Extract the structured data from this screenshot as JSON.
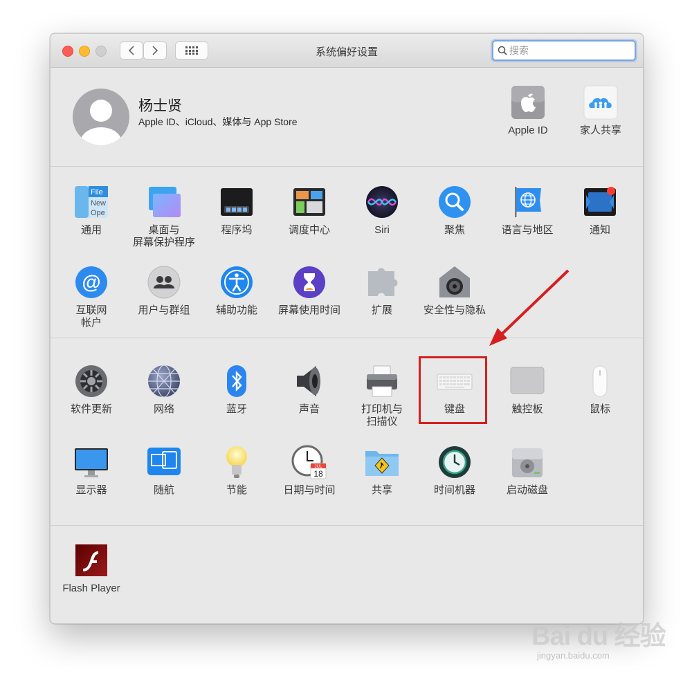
{
  "window": {
    "title": "系统偏好设置"
  },
  "search": {
    "placeholder": "搜索"
  },
  "user": {
    "name": "杨士贤",
    "subtitle": "Apple ID、iCloud、媒体与 App Store"
  },
  "top_right": [
    {
      "label": "Apple ID",
      "icon": "apple-id-icon"
    },
    {
      "label": "家人共享",
      "icon": "family-sharing-icon"
    }
  ],
  "section1": [
    {
      "label": "通用",
      "icon": "general-icon"
    },
    {
      "label": "桌面与",
      "label2": "屏幕保护程序",
      "icon": "desktop-screensaver-icon"
    },
    {
      "label": "程序坞",
      "icon": "dock-icon"
    },
    {
      "label": "调度中心",
      "icon": "mission-control-icon"
    },
    {
      "label": "Siri",
      "icon": "siri-icon"
    },
    {
      "label": "聚焦",
      "icon": "spotlight-icon"
    },
    {
      "label": "语言与地区",
      "icon": "language-region-icon"
    },
    {
      "label": "通知",
      "icon": "notifications-icon"
    },
    {
      "label": "互联网",
      "label2": "帐户",
      "icon": "internet-accounts-icon"
    },
    {
      "label": "用户与群组",
      "icon": "users-groups-icon"
    },
    {
      "label": "辅助功能",
      "icon": "accessibility-icon"
    },
    {
      "label": "屏幕使用时间",
      "icon": "screen-time-icon"
    },
    {
      "label": "扩展",
      "icon": "extensions-icon"
    },
    {
      "label": "安全性与隐私",
      "icon": "security-privacy-icon"
    }
  ],
  "section2": [
    {
      "label": "软件更新",
      "icon": "software-update-icon"
    },
    {
      "label": "网络",
      "icon": "network-icon"
    },
    {
      "label": "蓝牙",
      "icon": "bluetooth-icon"
    },
    {
      "label": "声音",
      "icon": "sound-icon"
    },
    {
      "label": "打印机与",
      "label2": "扫描仪",
      "icon": "printers-scanners-icon"
    },
    {
      "label": "键盘",
      "icon": "keyboard-icon"
    },
    {
      "label": "触控板",
      "icon": "trackpad-icon"
    },
    {
      "label": "鼠标",
      "icon": "mouse-icon"
    },
    {
      "label": "显示器",
      "icon": "displays-icon"
    },
    {
      "label": "随航",
      "icon": "sidecar-icon"
    },
    {
      "label": "节能",
      "icon": "energy-saver-icon"
    },
    {
      "label": "日期与时间",
      "icon": "date-time-icon"
    },
    {
      "label": "共享",
      "icon": "sharing-icon"
    },
    {
      "label": "时间机器",
      "icon": "time-machine-icon"
    },
    {
      "label": "启动磁盘",
      "icon": "startup-disk-icon"
    }
  ],
  "section3": [
    {
      "label": "Flash Player",
      "icon": "flash-player-icon"
    }
  ],
  "icon_text": {
    "general_file": "File",
    "general_new": "New",
    "general_open": "Ope",
    "calendar_month": "JUL",
    "calendar_day": "18"
  },
  "highlight": {
    "target": "键盘",
    "color": "#d51f1f"
  },
  "watermark": {
    "brand": "Bai du 经验",
    "url": "jingyan.baidu.com"
  }
}
